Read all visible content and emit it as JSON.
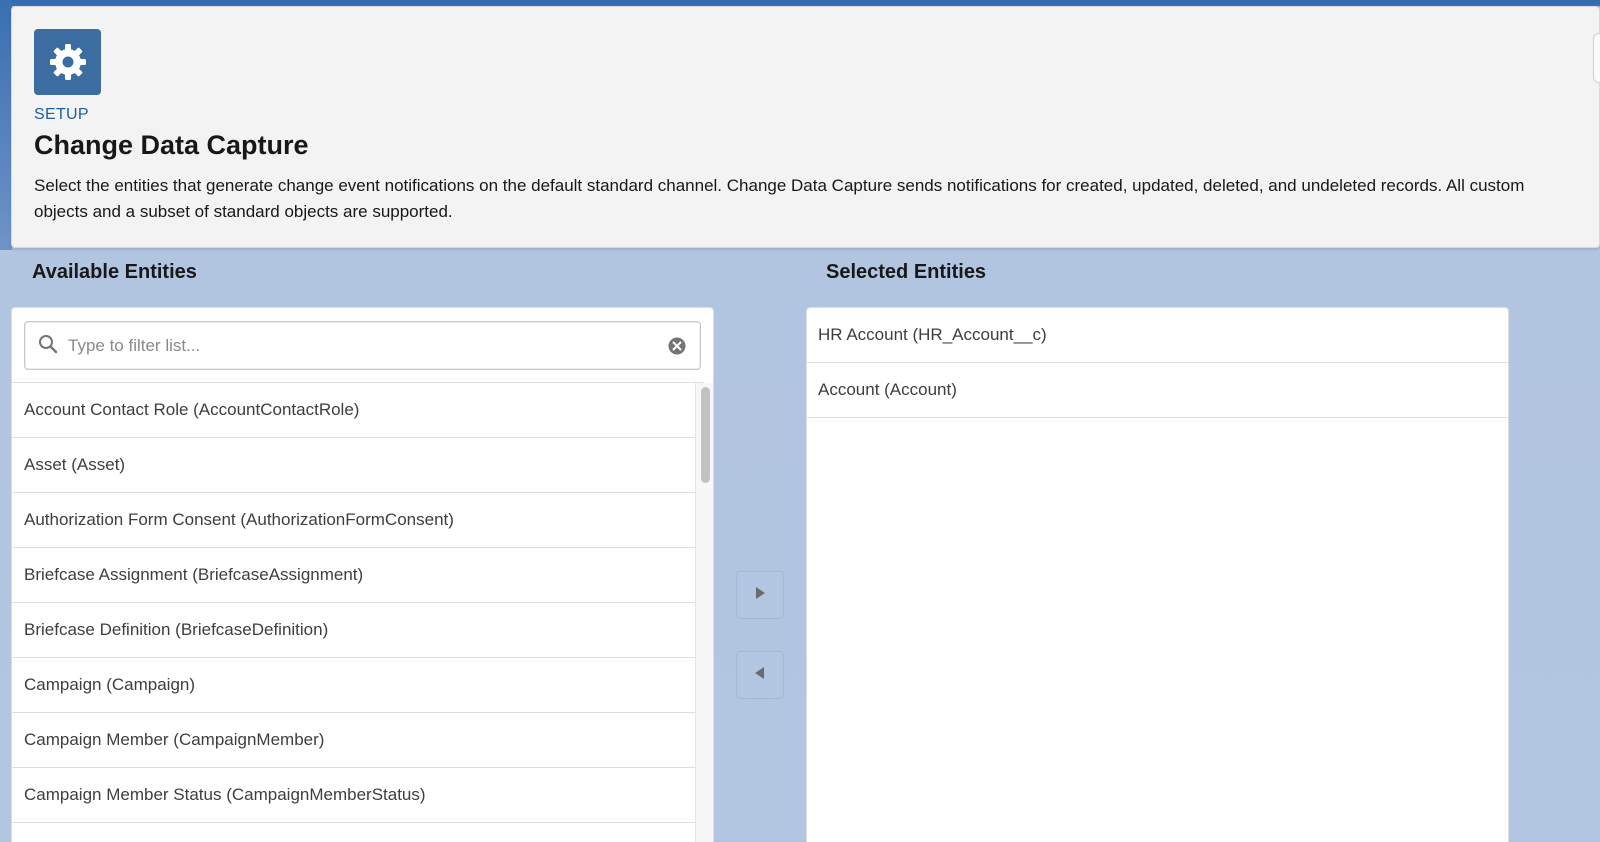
{
  "header": {
    "breadcrumb": "SETUP",
    "title": "Change Data Capture",
    "description": "Select the entities that generate change event notifications on the default standard channel. Change Data Capture sends notifications for created, updated, deleted, and undeleted records. All custom objects and a subset of standard objects are supported.",
    "icon": "gear-icon"
  },
  "available": {
    "heading": "Available Entities",
    "filter_placeholder": "Type to filter list...",
    "filter_value": "",
    "items": [
      "Account Contact Role (AccountContactRole)",
      "Asset (Asset)",
      "Authorization Form Consent (AuthorizationFormConsent)",
      "Briefcase Assignment (BriefcaseAssignment)",
      "Briefcase Definition (BriefcaseDefinition)",
      "Campaign (Campaign)",
      "Campaign Member (CampaignMember)",
      "Campaign Member Status (CampaignMemberStatus)"
    ]
  },
  "selected": {
    "heading": "Selected Entities",
    "items": [
      "HR Account (HR_Account__c)",
      "Account (Account)"
    ]
  },
  "colors": {
    "icon_bg": "#3c6da1",
    "setup_label": "#1b5f9e",
    "page_bg": "#b3c6e1"
  }
}
